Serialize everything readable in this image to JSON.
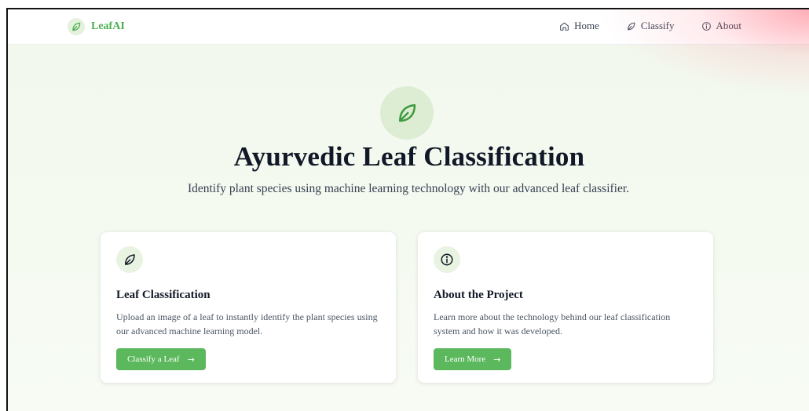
{
  "brand": {
    "name": "LeafAI",
    "icon": "leaf-icon"
  },
  "nav": {
    "items": [
      {
        "label": "Home",
        "icon": "home-icon"
      },
      {
        "label": "Classify",
        "icon": "leaf-icon"
      },
      {
        "label": "About",
        "icon": "info-icon"
      }
    ]
  },
  "hero": {
    "icon": "leaf-icon",
    "title": "Ayurvedic Leaf Classification",
    "subtitle": "Identify plant species using machine learning technology with our advanced leaf classifier."
  },
  "cards": [
    {
      "icon": "leaf-icon",
      "title": "Leaf Classification",
      "text": "Upload an image of a leaf to instantly identify the plant species using our advanced machine learning model.",
      "button": "Classify a Leaf",
      "button_icon": "arrow-right-icon"
    },
    {
      "icon": "info-icon",
      "title": "About the Project",
      "text": "Learn more about the technology behind our leaf classification system and how it was developed.",
      "button": "Learn More",
      "button_icon": "arrow-right-icon"
    }
  ],
  "colors": {
    "accent": "#5cb85c",
    "brand_text": "#4caf50",
    "icon_bg": "#dcedd3",
    "page_bg": "#f3f9ef"
  }
}
